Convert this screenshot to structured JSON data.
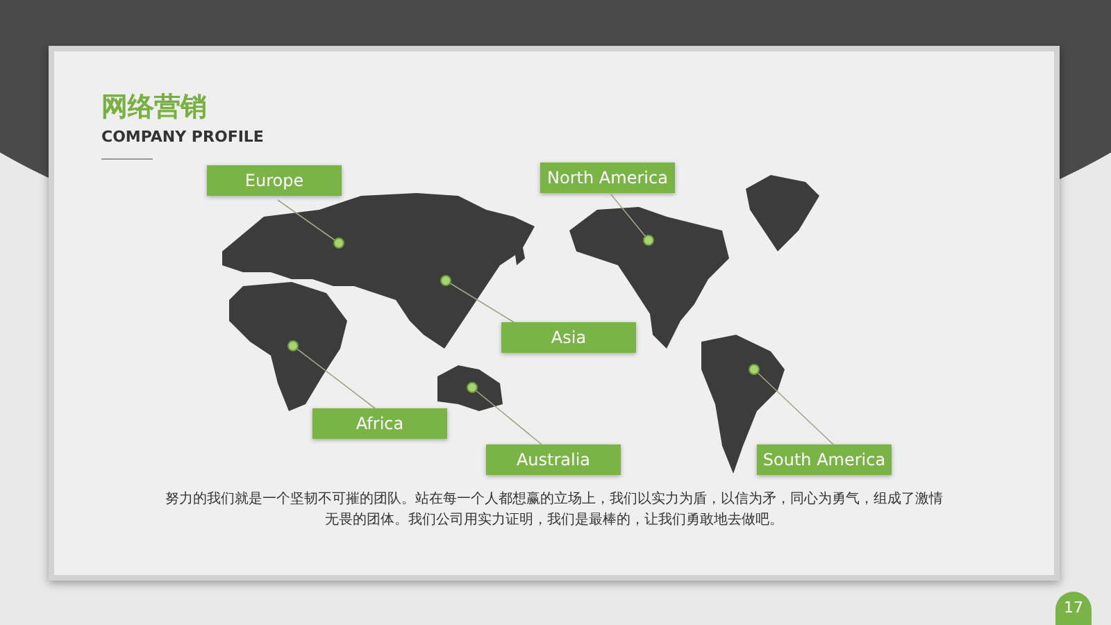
{
  "slide": {
    "title": "网络营销",
    "subtitle": "COMPANY PROFILE",
    "page_number": "17"
  },
  "regions": [
    {
      "label": "Europe"
    },
    {
      "label": "North America"
    },
    {
      "label": "Asia"
    },
    {
      "label": "Africa"
    },
    {
      "label": "Australia"
    },
    {
      "label": "South America"
    }
  ],
  "description": "努力的我们就是一个坚韧不可摧的团队。站在每一个人都想赢的立场上，我们以实力为盾，以信为矛，同心为勇气，组成了激情无畏的团体。我们公司用实力证明，我们是最棒的，让我们勇敢地去做吧。"
}
